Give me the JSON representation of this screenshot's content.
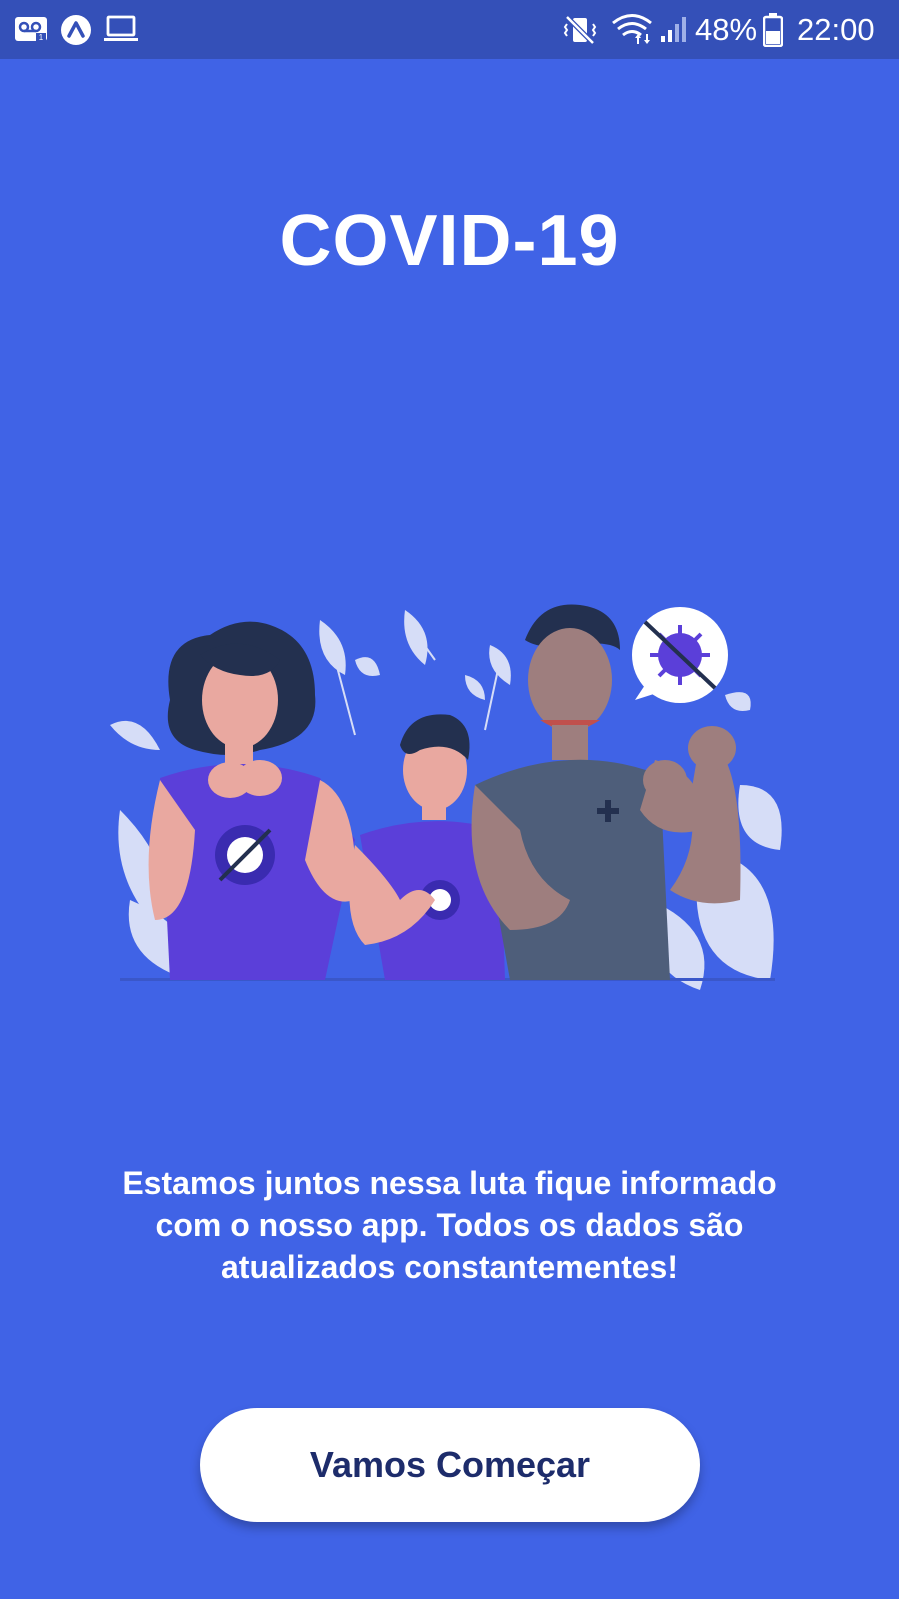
{
  "status_bar": {
    "battery_percent": "48%",
    "time": "22:00",
    "icons": [
      "voicemail-icon",
      "app-icon",
      "laptop-icon",
      "mute-vibrate-icon",
      "wifi-icon",
      "signal-icon",
      "battery-icon"
    ]
  },
  "title": "COVID-19",
  "illustration": {
    "description_icons": [
      "virus-crossed-icon",
      "speech-bubble-icon",
      "leaf-icon"
    ]
  },
  "description": "Estamos juntos nessa luta fique informado com o nosso app. Todos os dados são atualizados constantementes!",
  "button": {
    "label": "Vamos Começar"
  },
  "colors": {
    "background": "#4063E6",
    "status_bar": "#3450B8",
    "button_bg": "#FFFFFF",
    "button_text": "#1D2C6B",
    "shirt_purple": "#5B3FD9",
    "leaf_light": "#D6DDF7"
  }
}
